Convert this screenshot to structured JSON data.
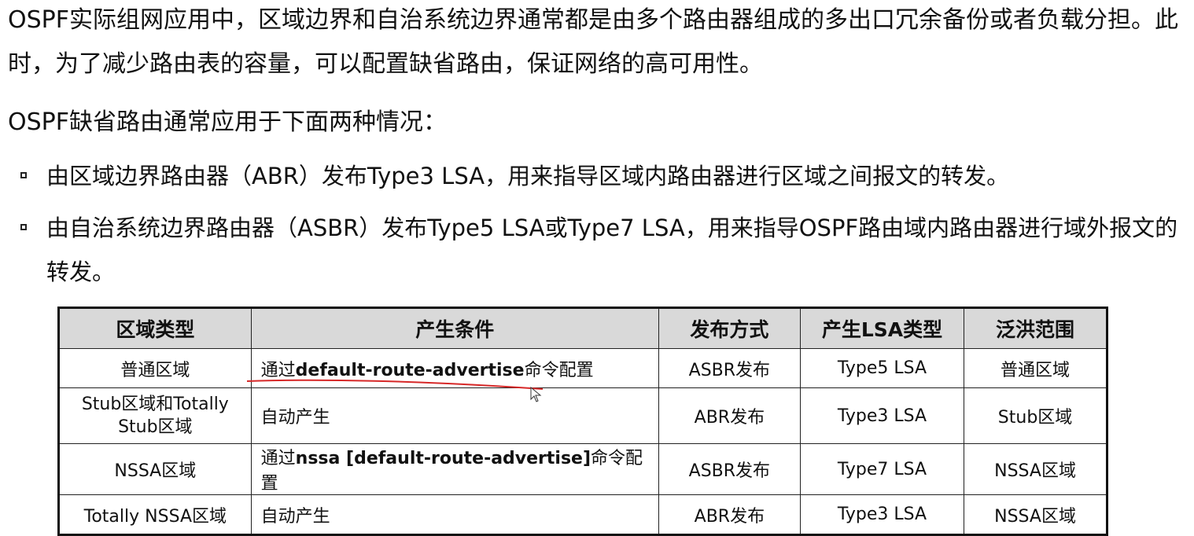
{
  "intro": {
    "paragraph1": "OSPF实际组网应用中，区域边界和自治系统边界通常都是由多个路由器组成的多出口冗余备份或者负载分担。此时，为了减少路由表的容量，可以配置缺省路由，保证网络的高可用性。",
    "paragraph2": "OSPF缺省路由通常应用于下面两种情况："
  },
  "bullets": [
    "由区域边界路由器（ABR）发布Type3 LSA，用来指导区域内路由器进行区域之间报文的转发。",
    "由自治系统边界路由器（ASBR）发布Type5 LSA或Type7 LSA，用来指导OSPF路由域内路由器进行域外报文的转发。"
  ],
  "table": {
    "headers": [
      "区域类型",
      "产生条件",
      "发布方式",
      "产生LSA类型",
      "泛洪范围"
    ],
    "rows": [
      {
        "area_type": "普通区域",
        "condition_prefix": "通过",
        "condition_command": "default-route-advertise",
        "condition_suffix": "命令配置",
        "publish": "ASBR发布",
        "lsa_type": "Type5 LSA",
        "flood_scope": "普通区域"
      },
      {
        "area_type": "Stub区域和Totally Stub区域",
        "condition": "自动产生",
        "publish": "ABR发布",
        "lsa_type": "Type3 LSA",
        "flood_scope": "Stub区域"
      },
      {
        "area_type": "NSSA区域",
        "condition_prefix": "通过",
        "condition_command": "nssa [default-route-advertise]",
        "condition_suffix": "命令配置",
        "publish": "ASBR发布",
        "lsa_type": "Type7 LSA",
        "flood_scope": "NSSA区域"
      },
      {
        "area_type": "Totally NSSA区域",
        "condition": "自动产生",
        "publish": "ABR发布",
        "lsa_type": "Type3 LSA",
        "flood_scope": "NSSA区域"
      }
    ]
  },
  "annotation": {
    "underline_color": "#d62828",
    "cursor_icon": "mouse-pointer-icon"
  }
}
